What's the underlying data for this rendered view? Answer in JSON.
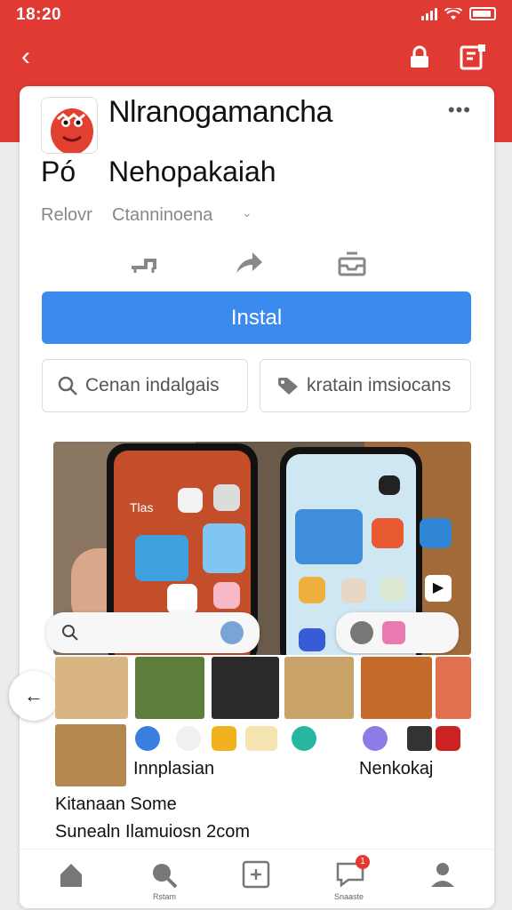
{
  "status_bar": {
    "time": "18:20",
    "icons": [
      "signal-icon",
      "wifi-icon",
      "battery-icon"
    ]
  },
  "nav": {
    "back_icon": "back-arrow-icon",
    "icons": [
      "lock-icon",
      "bookmark-icon"
    ]
  },
  "app": {
    "title": "Nlranogamancha",
    "subtitle_left": "Pó",
    "subtitle_right": "Nehopakaiah",
    "meta_label": "Relovr",
    "meta_value": "Ctanninoena",
    "more_icon": "more-dots-icon"
  },
  "actions": {
    "icons": [
      "cart-icon",
      "share-icon",
      "inbox-icon"
    ]
  },
  "install_button": "Instal",
  "secondary_buttons": [
    {
      "label": "Cenan indalgais",
      "icon": "search-icon"
    },
    {
      "label": "kratain imsiocans",
      "icon": "tag-icon"
    }
  ],
  "screenshot": {
    "overlay_text": "Tlas"
  },
  "labels": {
    "left_caption": "Innplasian",
    "right_caption": "Nenkokaj",
    "line1": "Kitanaan Some",
    "line2": "Sunealn Ilamuiosn 2com",
    "left_arrow": "←"
  },
  "bottom_nav": [
    {
      "icon": "home-icon",
      "label": ""
    },
    {
      "icon": "search-icon",
      "label": "Rstam"
    },
    {
      "icon": "add-icon",
      "label": ""
    },
    {
      "icon": "chat-icon",
      "label": "Snaaste",
      "badge": "1"
    },
    {
      "icon": "profile-icon",
      "label": ""
    }
  ],
  "colors": {
    "brand": "#e03a32",
    "accent": "#3b8bef"
  }
}
